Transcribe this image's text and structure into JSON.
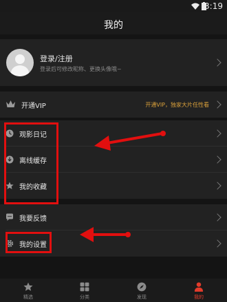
{
  "status_bar": {
    "time": "3:19"
  },
  "header": {
    "title": "我的"
  },
  "profile": {
    "login_label": "登录/注册",
    "hint": "登录后可修改昵称、更换头像哦~"
  },
  "vip": {
    "label": "开通VIP",
    "promo": "开通VIP，独家大片任性看"
  },
  "menu_group_1": [
    {
      "label": "观影日记",
      "icon": "clock-icon"
    },
    {
      "label": "离线缓存",
      "icon": "download-icon"
    },
    {
      "label": "我的收藏",
      "icon": "star-icon"
    }
  ],
  "menu_group_2": [
    {
      "label": "我要反馈",
      "icon": "chat-bubble-icon"
    },
    {
      "label": "我的设置",
      "icon": "gear-icon"
    }
  ],
  "bottom_nav": [
    {
      "label": "精选",
      "icon": "star-icon",
      "active": false
    },
    {
      "label": "分类",
      "icon": "grid-icon",
      "active": false
    },
    {
      "label": "发现",
      "icon": "compass-icon",
      "active": false
    },
    {
      "label": "我的",
      "icon": "person-icon",
      "active": true
    }
  ],
  "annotation_color": "#e20f0f"
}
